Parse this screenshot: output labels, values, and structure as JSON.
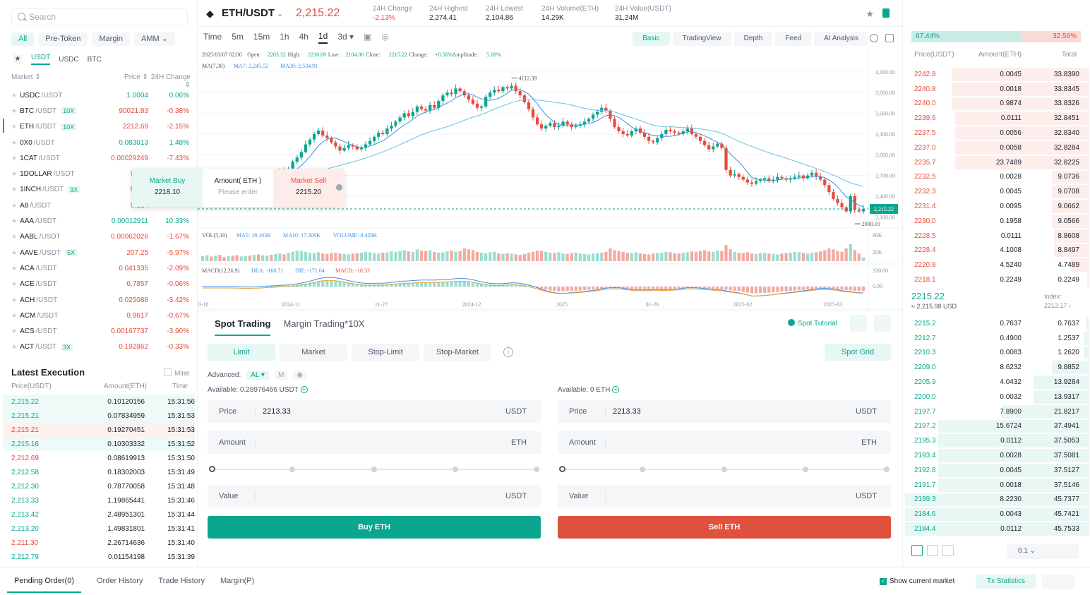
{
  "left": {
    "search_placeholder": "Search",
    "cat_tabs": [
      "All",
      "Pre-Token",
      "Margin",
      "AMM ⌄"
    ],
    "quote_tabs": [
      "USDT",
      "USDC",
      "BTC"
    ],
    "head": {
      "market": "Market ⇕",
      "price": "Price ⇕",
      "change": "24H Change ⇕"
    },
    "markets": [
      {
        "base": "USDC",
        "quote": "/USDT",
        "lev": "",
        "price": "1.0004",
        "change": "0.06%",
        "up": true
      },
      {
        "base": "BTC",
        "quote": "/USDT",
        "lev": "10X",
        "price": "90021.83",
        "change": "-0.38%",
        "up": false
      },
      {
        "base": "ETH",
        "quote": "/USDT",
        "lev": "10X",
        "price": "2212.69",
        "change": "-2.15%",
        "up": false
      },
      {
        "base": "0X0",
        "quote": "/USDT",
        "lev": "",
        "price": "0.083013",
        "change": "1.48%",
        "up": true
      },
      {
        "base": "1CAT",
        "quote": "/USDT",
        "lev": "",
        "price": "0.00029249",
        "change": "-7.43%",
        "up": false
      },
      {
        "base": "1DOLLAR",
        "quote": "/USDT",
        "lev": "",
        "price": "0.006",
        "change": "",
        "up": false
      },
      {
        "base": "1INCH",
        "quote": "/USDT",
        "lev": "3X",
        "price": "0.232",
        "change": "",
        "up": false
      },
      {
        "base": "A8",
        "quote": "/USDT",
        "lev": "",
        "price": "0.124",
        "change": "",
        "up": false
      },
      {
        "base": "AAA",
        "quote": "/USDT",
        "lev": "",
        "price": "0.00012911",
        "change": "10.33%",
        "up": true
      },
      {
        "base": "AABL",
        "quote": "/USDT",
        "lev": "",
        "price": "0.00062026",
        "change": "-1.67%",
        "up": false
      },
      {
        "base": "AAVE",
        "quote": "/USDT",
        "lev": "5X",
        "price": "207.25",
        "change": "-5.97%",
        "up": false
      },
      {
        "base": "ACA",
        "quote": "/USDT",
        "lev": "",
        "price": "0.041335",
        "change": "-2.09%",
        "up": false
      },
      {
        "base": "ACE",
        "quote": "/USDT",
        "lev": "",
        "price": "0.7857",
        "change": "-0.06%",
        "up": false
      },
      {
        "base": "ACH",
        "quote": "/USDT",
        "lev": "",
        "price": "0.025088",
        "change": "-3.42%",
        "up": false
      },
      {
        "base": "ACM",
        "quote": "/USDT",
        "lev": "",
        "price": "0.9617",
        "change": "-0.67%",
        "up": false
      },
      {
        "base": "ACS",
        "quote": "/USDT",
        "lev": "",
        "price": "0.00167737",
        "change": "-3.90%",
        "up": false
      },
      {
        "base": "ACT",
        "quote": "/USDT",
        "lev": "3X",
        "price": "0.192862",
        "change": "-0.33%",
        "up": false
      }
    ],
    "quick": {
      "buy_label": "Market Buy",
      "buy_price": "2218.10",
      "amount_label": "Amount( ETH )",
      "amount_placeholder": "Please enter",
      "sell_label": "Market Sell",
      "sell_price": "2215.20"
    },
    "latest": {
      "title": "Latest Execution",
      "mine": "Mine",
      "head": {
        "price": "Price(USDT)",
        "amount": "Amount(ETH)",
        "time": "Time"
      },
      "rows": [
        {
          "p": "2,215.22",
          "a": "0.10120156",
          "t": "15:31:56",
          "up": true,
          "bg": "g"
        },
        {
          "p": "2,215.21",
          "a": "0.07834959",
          "t": "15:31:53",
          "up": true,
          "bg": "g"
        },
        {
          "p": "2,215.21",
          "a": "0.19270451",
          "t": "15:31:53",
          "up": false,
          "bg": "r"
        },
        {
          "p": "2,215.16",
          "a": "0.10303332",
          "t": "15:31:52",
          "up": true,
          "bg": "g"
        },
        {
          "p": "2,212.69",
          "a": "0.08619913",
          "t": "15:31:50",
          "up": false,
          "bg": ""
        },
        {
          "p": "2,212.58",
          "a": "0.18302003",
          "t": "15:31:49",
          "up": true,
          "bg": ""
        },
        {
          "p": "2,212.30",
          "a": "0.78770058",
          "t": "15:31:48",
          "up": true,
          "bg": ""
        },
        {
          "p": "2,213.33",
          "a": "1.19865441",
          "t": "15:31:46",
          "up": true,
          "bg": ""
        },
        {
          "p": "2,213.42",
          "a": "2.48951301",
          "t": "15:31:44",
          "up": true,
          "bg": ""
        },
        {
          "p": "2,213.20",
          "a": "1.49831801",
          "t": "15:31:41",
          "up": true,
          "bg": ""
        },
        {
          "p": "2,211.30",
          "a": "2.26714636",
          "t": "15:31:40",
          "up": false,
          "bg": ""
        },
        {
          "p": "2,212.79",
          "a": "0.01154198",
          "t": "15:31:39",
          "up": true,
          "bg": ""
        }
      ]
    }
  },
  "ticker": {
    "pair": "ETH/USDT",
    "last": "2,215.22",
    "stats": [
      {
        "label": "24H Change",
        "value": "-2.13%",
        "down": true
      },
      {
        "label": "24H Highest",
        "value": "2,274.41",
        "down": false
      },
      {
        "label": "24H Lowest",
        "value": "2,104.86",
        "down": false
      },
      {
        "label": "24H Volume(ETH)",
        "value": "14.29K",
        "down": false
      },
      {
        "label": "24H Value(USDT)",
        "value": "31.24M",
        "down": false
      }
    ]
  },
  "toolbar": {
    "timeframes": [
      "Time",
      "5m",
      "15m",
      "1h",
      "4h",
      "1d",
      "3d ▾"
    ],
    "active_tf": "1d",
    "views": [
      "Basic",
      "TradingView",
      "Depth",
      "Feed",
      "AI Analysis"
    ]
  },
  "chart_data": {
    "type": "candlestick",
    "info_line": {
      "date": "2025/03/07 02:00",
      "open_l": "Open:",
      "open": "2203.32",
      "high_l": "High:",
      "high": "2230.00",
      "low_l": "Low:",
      "low": "2104.86",
      "close_l": "Close:",
      "close": "2215.22",
      "change_l": "Change:",
      "change": "+0.56%",
      "amp_l": "Amplitude:",
      "amp": "5.68%"
    },
    "ma_line": {
      "label": "MA(7,30)",
      "ma7": "MA7: 2,245.52",
      "ma30": "MA30: 2,534.91"
    },
    "price_axis": [
      "4,200.00",
      "3,900.00",
      "3,600.00",
      "3,300.00",
      "3,000.00",
      "2,700.00",
      "2,400.00",
      "2,100.00"
    ],
    "price_range": [
      1950,
      4260
    ],
    "max_label": "4112.39",
    "min_label": "2000.10",
    "last_price": "2,215.22",
    "vol_line": {
      "label": "VOL(5,10)",
      "ma5": "MA5: 18.103K",
      "ma10": "MA10: 17.306K",
      "vol": "VOLUME: 8.428K"
    },
    "vol_axis": [
      "60K",
      "20K"
    ],
    "macd_line": {
      "label": "MACD(12,26,9)",
      "dea": "DEA: -160.71",
      "dif": "DIF: -171.04",
      "macd": "MACD: -10.33"
    },
    "macd_axis": [
      "320.00",
      "0.00"
    ],
    "x_labels": [
      "0-18",
      "2024-11",
      "11-27",
      "2024-12",
      "2025",
      "01-26",
      "2025-02",
      "2025-03"
    ],
    "closes": [
      2620,
      2640,
      2600,
      2650,
      2580,
      2560,
      2600,
      2540,
      2520,
      2560,
      2620,
      2600,
      2640,
      2620,
      2660,
      2700,
      2680,
      2720,
      2760,
      2740,
      2800,
      2900,
      2960,
      3040,
      3150,
      3220,
      3300,
      3350,
      3280,
      3240,
      3180,
      3120,
      3060,
      3100,
      3140,
      3120,
      3080,
      3100,
      3150,
      3200,
      3260,
      3320,
      3300,
      3380,
      3420,
      3480,
      3540,
      3600,
      3560,
      3620,
      3700,
      3660,
      3640,
      3720,
      3680,
      3780,
      3860,
      3900,
      3880,
      3960,
      3920,
      3860,
      3800,
      3740,
      3680,
      3700,
      3840,
      3900,
      3940,
      3920,
      3980,
      3960,
      4000,
      3920,
      3860,
      3760,
      3660,
      3540,
      3440,
      3380,
      3420,
      3460,
      3400,
      3420,
      3480,
      3440,
      3400,
      3420,
      3440,
      3480,
      3520,
      3580,
      3620,
      3680,
      3640,
      3520,
      3400,
      3340,
      3300,
      3280,
      3340,
      3380,
      3320,
      3260,
      3200,
      3180,
      3240,
      3300,
      3360,
      3340,
      3320,
      3300,
      3340,
      3380,
      3300,
      3260,
      3200,
      3140,
      3080,
      3120,
      3160,
      3100,
      2780,
      2700,
      2720,
      2680,
      2640,
      2600,
      2580,
      2620,
      2640,
      2660,
      2620,
      2640,
      2680,
      2660,
      2640,
      2660,
      2680,
      2700,
      2660,
      2700,
      2740,
      2680,
      2640,
      2560,
      2460,
      2360,
      2300,
      2240,
      2180,
      2400,
      2200,
      2180,
      2215
    ],
    "volumes": [
      12,
      14,
      11,
      13,
      15,
      10,
      12,
      13,
      14,
      11,
      12,
      13,
      15,
      16,
      14,
      13,
      15,
      17,
      18,
      16,
      20,
      22,
      25,
      24,
      22,
      20,
      19,
      21,
      18,
      17,
      19,
      20,
      18,
      17,
      16,
      18,
      19,
      20,
      22,
      21,
      19,
      18,
      20,
      21,
      23,
      22,
      24,
      26,
      23,
      22,
      28,
      25,
      24,
      26,
      22,
      20,
      21,
      23,
      25,
      22,
      24,
      30,
      28,
      26,
      22,
      20,
      19,
      21,
      22,
      18,
      17,
      19,
      18,
      16,
      15,
      17,
      20,
      22,
      25,
      24,
      22,
      20,
      19,
      21,
      18,
      17,
      19,
      20,
      18,
      17,
      16,
      18,
      19,
      20,
      22,
      30,
      26,
      24,
      22,
      20,
      19,
      21,
      18,
      17,
      16,
      18,
      19,
      20,
      22,
      21,
      19,
      18,
      20,
      21,
      23,
      22,
      24,
      26,
      23,
      22,
      25,
      24,
      38,
      28,
      22,
      20,
      19,
      21,
      18,
      17,
      19,
      20,
      18,
      17,
      16,
      18,
      19,
      20,
      22,
      21,
      19,
      18,
      20,
      21,
      23,
      26,
      30,
      28,
      24,
      22,
      30,
      40,
      26,
      18,
      9
    ]
  },
  "trade": {
    "tabs": [
      "Spot Trading",
      "Margin Trading*10X"
    ],
    "tutorial": "Spot Tutorial",
    "order_types": [
      "Limit",
      "Market",
      "Stop-Limit",
      "Stop-Market"
    ],
    "spot_grid": "Spot Grid",
    "advanced": "Advanced:",
    "al": "AL ▾",
    "m": "M",
    "buy": {
      "available": "Available: 0.28976466 USDT",
      "price_label": "Price",
      "price": "2213.33",
      "price_unit": "USDT",
      "amount_label": "Amount",
      "amount_unit": "ETH",
      "value_label": "Value",
      "value_unit": "USDT",
      "button": "Buy ETH"
    },
    "sell": {
      "available": "Available: 0 ETH",
      "price_label": "Price",
      "price": "2213.33",
      "price_unit": "USDT",
      "amount_label": "Amount",
      "amount_unit": "ETH",
      "value_label": "Value",
      "value_unit": "USDT",
      "button": "Sell ETH"
    }
  },
  "orderbook": {
    "buy_ratio": "67.44%",
    "sell_ratio": "32.56%",
    "head": {
      "price": "Price(USDT)",
      "amount": "Amount(ETH)",
      "total": "Total"
    },
    "asks": [
      {
        "p": "2242.8",
        "a": "0.0045",
        "t": "33.8390",
        "d": 0.74
      },
      {
        "p": "2240.8",
        "a": "0.0018",
        "t": "33.8345",
        "d": 0.74
      },
      {
        "p": "2240.0",
        "a": "0.9874",
        "t": "33.8326",
        "d": 0.74
      },
      {
        "p": "2239.6",
        "a": "0.0111",
        "t": "32.8451",
        "d": 0.72
      },
      {
        "p": "2237.5",
        "a": "0.0056",
        "t": "32.8340",
        "d": 0.72
      },
      {
        "p": "2237.0",
        "a": "0.0058",
        "t": "32.8284",
        "d": 0.72
      },
      {
        "p": "2235.7",
        "a": "23.7489",
        "t": "32.8225",
        "d": 0.72
      },
      {
        "p": "2232.5",
        "a": "0.0028",
        "t": "9.0736",
        "d": 0.2
      },
      {
        "p": "2232.3",
        "a": "0.0045",
        "t": "9.0708",
        "d": 0.2
      },
      {
        "p": "2231.4",
        "a": "0.0095",
        "t": "9.0662",
        "d": 0.2
      },
      {
        "p": "2230.0",
        "a": "0.1958",
        "t": "9.0566",
        "d": 0.2
      },
      {
        "p": "2228.5",
        "a": "0.0111",
        "t": "8.8608",
        "d": 0.19
      },
      {
        "p": "2228.4",
        "a": "4.1008",
        "t": "8.8497",
        "d": 0.19
      },
      {
        "p": "2220.8",
        "a": "4.5240",
        "t": "4.7489",
        "d": 0.1
      },
      {
        "p": "2218.1",
        "a": "0.2249",
        "t": "0.2249",
        "d": 0.01
      }
    ],
    "mid": {
      "price": "2215.22",
      "sub": "≈ 2,215.98  USD",
      "index_label": "Index:",
      "index": "2213.17"
    },
    "bids": [
      {
        "p": "2215.2",
        "a": "0.7637",
        "t": "0.7637",
        "d": 0.02
      },
      {
        "p": "2212.7",
        "a": "0.4900",
        "t": "1.2537",
        "d": 0.03
      },
      {
        "p": "2210.3",
        "a": "0.0083",
        "t": "1.2620",
        "d": 0.03
      },
      {
        "p": "2209.0",
        "a": "8.6232",
        "t": "9.8852",
        "d": 0.2
      },
      {
        "p": "2205.9",
        "a": "4.0432",
        "t": "13.9284",
        "d": 0.3
      },
      {
        "p": "2200.0",
        "a": "0.0032",
        "t": "13.9317",
        "d": 0.3
      },
      {
        "p": "2197.7",
        "a": "7.8900",
        "t": "21.8217",
        "d": 0.47
      },
      {
        "p": "2197.2",
        "a": "15.6724",
        "t": "37.4941",
        "d": 0.81
      },
      {
        "p": "2195.3",
        "a": "0.0112",
        "t": "37.5053",
        "d": 0.81
      },
      {
        "p": "2193.4",
        "a": "0.0028",
        "t": "37.5081",
        "d": 0.81
      },
      {
        "p": "2192.8",
        "a": "0.0045",
        "t": "37.5127",
        "d": 0.81
      },
      {
        "p": "2191.7",
        "a": "0.0018",
        "t": "37.5146",
        "d": 0.81
      },
      {
        "p": "2189.3",
        "a": "8.2230",
        "t": "45.7377",
        "d": 0.99
      },
      {
        "p": "2184.6",
        "a": "0.0043",
        "t": "45.7421",
        "d": 0.99
      },
      {
        "p": "2184.4",
        "a": "0.0112",
        "t": "45.7533",
        "d": 0.99
      }
    ],
    "precision": "0.1     ⌄"
  },
  "bottom": {
    "tabs": [
      "Pending Order(0)",
      "Order History",
      "Trade History",
      "Margin(P)"
    ],
    "show_current": "Show current market",
    "tx_stats": "Tx Statistics"
  },
  "colors": {
    "up": "#0aa68d",
    "down": "#e74c3c",
    "accent": "#0aa68d"
  }
}
